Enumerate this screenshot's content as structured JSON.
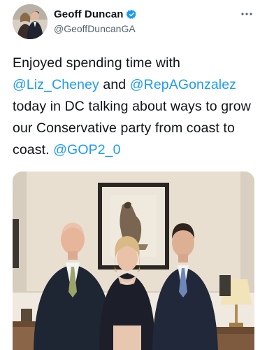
{
  "author": {
    "display_name": "Geoff Duncan",
    "handle": "@GeoffDuncanGA",
    "verified": true
  },
  "tweet": {
    "segments": [
      {
        "text": "Enjoyed spending time with ",
        "type": "text"
      },
      {
        "text": "@Liz_Cheney",
        "type": "mention"
      },
      {
        "text": " and ",
        "type": "text"
      },
      {
        "text": "@RepAGonzalez",
        "type": "mention"
      },
      {
        "text": " today in DC talking about ways to grow our Conservative party from coast to coast. ",
        "type": "text"
      },
      {
        "text": "@GOP2_0",
        "type": "mention"
      }
    ]
  },
  "icons": {
    "verified": "verified-badge-icon",
    "more": "more-options-icon"
  },
  "colors": {
    "mention": "#1d9bf0",
    "verified": "#1d9bf0",
    "text": "#0f1419",
    "secondary": "#536471"
  }
}
